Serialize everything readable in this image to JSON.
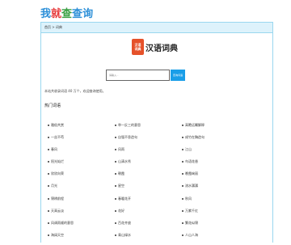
{
  "logo": {
    "chars": [
      "我",
      "就",
      "查",
      "查",
      "询"
    ]
  },
  "breadcrumb": {
    "home": "首页",
    "separator": " > ",
    "current": "词典"
  },
  "brand": {
    "icon_line1": "汉语",
    "icon_line2": "词典",
    "title": "汉语词典"
  },
  "search": {
    "placeholder": "请输入...",
    "button": "查询词语"
  },
  "stats": {
    "text": "本站共收录词语 40 万个，欢迎查询使用。"
  },
  "section": {
    "title": "热门词语"
  },
  "words": [
    [
      "雅俗共赏",
      "举一反三的意思",
      "高瞻远瞩解释"
    ],
    [
      "一丝不苟",
      "自强不息造句",
      "成竹在胸造句"
    ],
    [
      "春风",
      "风雨",
      "江山"
    ],
    [
      "阳光灿烂",
      "山清水秀",
      "鸟语花香"
    ],
    [
      "欣欣向荣",
      "朝霞",
      "晚霞绚丽"
    ],
    [
      "月光",
      "星空",
      "流水潺潺"
    ],
    [
      "锦绣前程",
      "春暖花开",
      "秋风"
    ],
    [
      "天高云淡",
      "花好",
      "万紫千红"
    ],
    [
      "风调雨顺的意思",
      "百花齐放",
      "繁花似锦"
    ],
    [
      "海阔天空",
      "青山绿水",
      "人山人海"
    ]
  ]
}
